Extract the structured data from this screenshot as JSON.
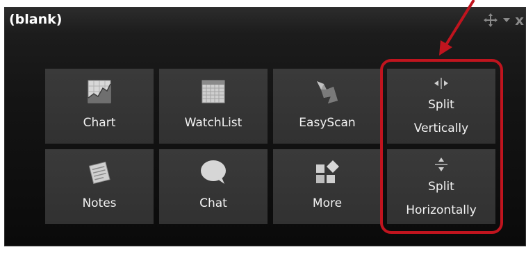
{
  "window": {
    "title": "(blank)",
    "close_label": "x"
  },
  "tiles": [
    {
      "label": "Chart",
      "icon": "chart-icon"
    },
    {
      "label": "WatchList",
      "icon": "watchlist-icon"
    },
    {
      "label": "EasyScan",
      "icon": "easyscan-icon"
    },
    {
      "label_line1": "Split",
      "label_line2": "Vertically",
      "icon": "split-vertical-icon"
    },
    {
      "label": "Notes",
      "icon": "notes-icon"
    },
    {
      "label": "Chat",
      "icon": "chat-icon"
    },
    {
      "label": "More",
      "icon": "more-icon"
    },
    {
      "label_line1": "Split",
      "label_line2": "Horizontally",
      "icon": "split-horizontal-icon"
    }
  ],
  "colors": {
    "tile_bg": "#363636",
    "panel_bg": "#141414",
    "highlight": "#c0141e",
    "text": "#f2f2f2"
  }
}
